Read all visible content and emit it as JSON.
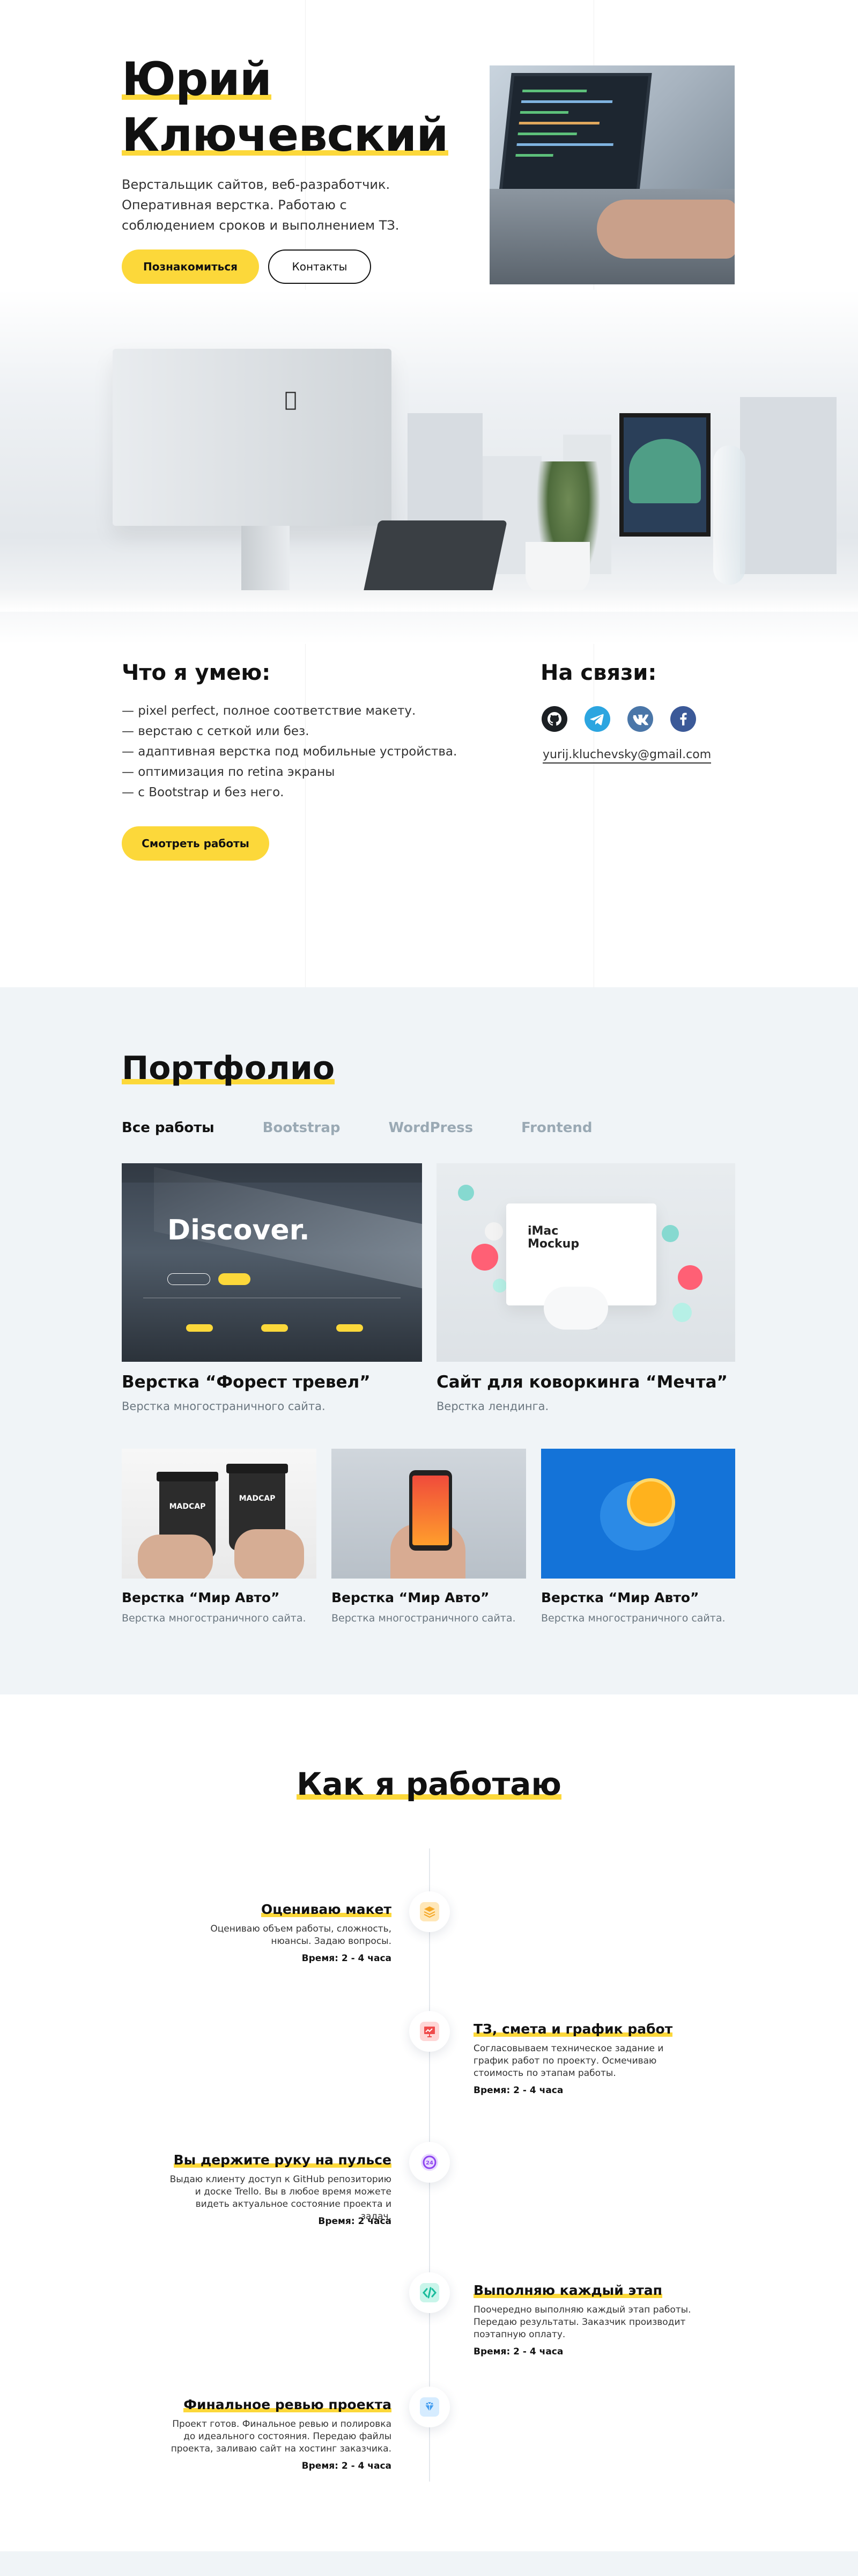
{
  "hero": {
    "name_line1": "Юрий",
    "name_line2": "Ключевский",
    "description": "Верстальщик сайтов, веб-разработчик. Оперативная верстка. Работаю с соблюдением сроков и выполнением ТЗ.",
    "btn_meet": "Познакомиться",
    "btn_contacts": "Контакты"
  },
  "skills": {
    "title": "Что я умею:",
    "items": [
      "— pixel perfect, полное соответствие макету.",
      "— верстаю с сеткой или без.",
      "— адаптивная верстка под мобильные устройства.",
      "— оптимизация по retina экраны",
      "— с Bootstrap и без него."
    ],
    "btn_works": "Смотреть работы"
  },
  "contacts": {
    "title": "На связи:",
    "icons": [
      "github-icon",
      "telegram-icon",
      "vk-icon",
      "facebook-icon"
    ],
    "email": "yurij.kluchevsky@gmail.com"
  },
  "portfolio": {
    "title": "Портфолио",
    "tabs": [
      "Все работы",
      "Bootstrap",
      "WordPress",
      "Frontend"
    ],
    "cards": [
      {
        "title": "Верстка “Форест тревел”",
        "subtitle": "Верстка многостраничного сайта.",
        "image_text": "Discover."
      },
      {
        "title": "Сайт для коворкинга “Мечта”",
        "subtitle": "Верстка лендинга.",
        "image_text": "iMac Mockup"
      },
      {
        "title": "Верстка “Мир Авто”",
        "subtitle": "Верстка многостраничного сайта.",
        "image_text": "MADCAP"
      },
      {
        "title": "Верстка “Мир Авто”",
        "subtitle": "Верстка многостраничного сайта."
      },
      {
        "title": "Верстка “Мир Авто”",
        "subtitle": "Верстка многостраничного сайта."
      }
    ]
  },
  "work": {
    "title": "Как я работаю",
    "steps": [
      {
        "title": "Оцениваю макет",
        "text": "Оцениваю объем работы, сложность, нюансы. Задаю вопросы.",
        "time": "Время: 2 - 4 часа",
        "icon": "layers-icon"
      },
      {
        "title": "ТЗ, смета и график работ",
        "text": "Согласовываем техническое задание и график работ по проекту. Осмечиваю стоимость по этапам работы.",
        "time": "Время: 2 - 4 часа",
        "icon": "presentation-icon"
      },
      {
        "title": "Вы держите руку на пульсе",
        "text": "Выдаю клиенту доступ к GitHub репозиторию и доске Trello. Вы в любое время можете видеть актуальное состояние проекта и задач.",
        "time": "Время: 2 часа",
        "icon": "clock-24-icon"
      },
      {
        "title": "Выполняю каждый этап",
        "text": "Поочередно выполняю каждый этап работы. Передаю результаты. Заказчик производит поэтапную оплату.",
        "time": "Время: 2 - 4 часа",
        "icon": "code-icon"
      },
      {
        "title": "Финальное ревью проекта",
        "text": "Проект готов. Финальное ревью и полировка до идеального состояния. Передаю файлы проекта, заливаю сайт на хостинг заказчика.",
        "time": "Время: 2 - 4 часа",
        "icon": "diamond-icon"
      }
    ]
  },
  "colors": {
    "accent": "#fcd83a",
    "portfolio_bg": "#f0f4f7",
    "tab_inactive": "#9aa9b4",
    "text": "#111111"
  }
}
